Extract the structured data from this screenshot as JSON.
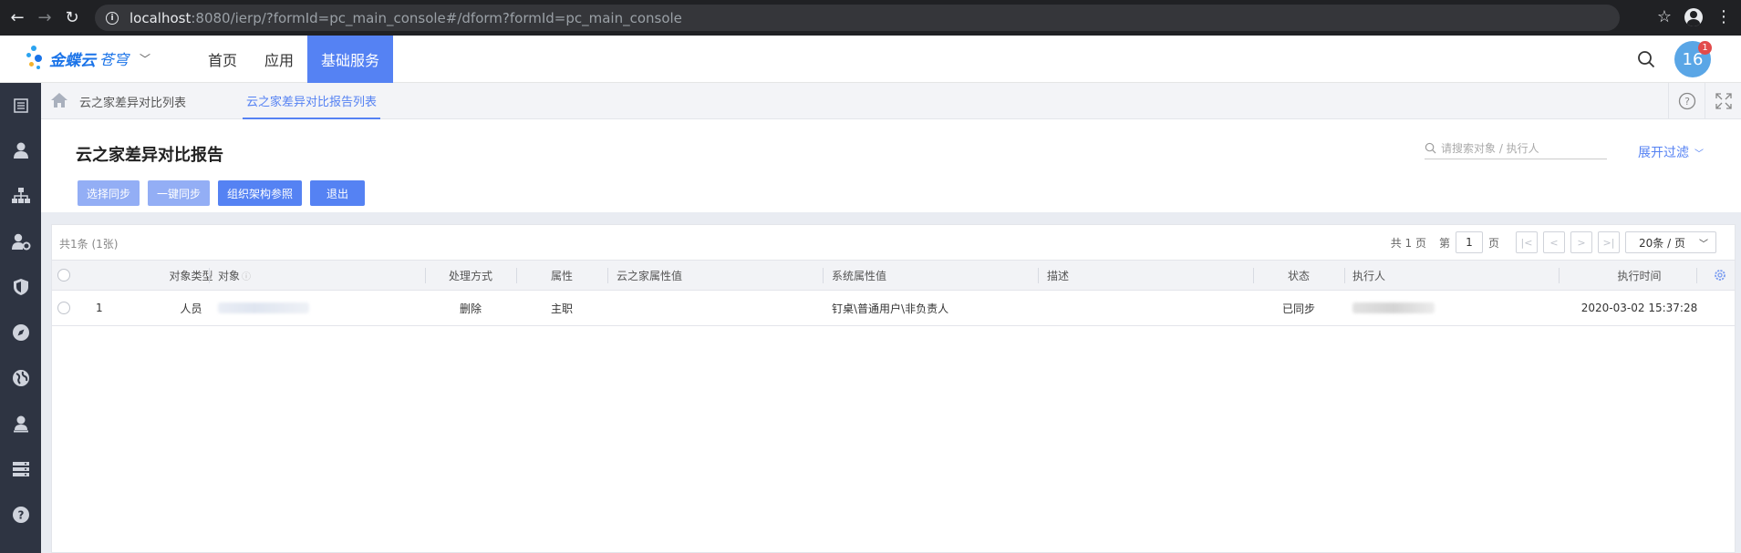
{
  "browser": {
    "url_host": "localhost",
    "url_rest": ":8080/ierp/?formId=pc_main_console#/dform?formId=pc_main_console"
  },
  "header": {
    "logo_text": "金蝶云",
    "logo_sub": "苍穹",
    "nav": [
      {
        "label": "首页"
      },
      {
        "label": "应用"
      },
      {
        "label": "基础服务"
      }
    ],
    "user_initials": "16",
    "notification_count": "1",
    "colors": {
      "accent": "#5582f3",
      "avatar": "#5aa6e6"
    }
  },
  "sidebar": {
    "icons": [
      "list-icon",
      "user-icon",
      "org-chart-icon",
      "user-settings-icon",
      "shield-icon",
      "compass-icon",
      "globe-icon",
      "person-stamp-icon",
      "server-icon",
      "help-icon"
    ]
  },
  "tabs": [
    {
      "label": "云之家差异对比列表"
    },
    {
      "label": "云之家差异对比报告列表"
    }
  ],
  "page": {
    "title": "云之家差异对比报告",
    "search_placeholder": "请搜索对象 / 执行人",
    "expand_filter": "展开过滤"
  },
  "toolbar": {
    "buttons": [
      {
        "label": "选择同步"
      },
      {
        "label": "一键同步"
      },
      {
        "label": "组织架构参照"
      },
      {
        "label": "退出"
      }
    ]
  },
  "grid": {
    "summary": "共1条 (1张)",
    "pager": {
      "total_pages": "共 1 页",
      "page_prefix": "第",
      "current_page": "1",
      "page_suffix": "页",
      "page_size": "20条 / 页"
    },
    "columns": [
      "对象类型",
      "对象",
      "处理方式",
      "属性",
      "云之家属性值",
      "系统属性值",
      "描述",
      "状态",
      "执行人",
      "执行时间"
    ],
    "rows": [
      {
        "index": "1",
        "type": "人员",
        "action": "删除",
        "attribute": "主职",
        "yzj_value": "",
        "sys_value": "钉桌\\普通用户\\非负责人",
        "desc": "",
        "status": "已同步",
        "time": "2020-03-02 15:37:28"
      }
    ]
  }
}
